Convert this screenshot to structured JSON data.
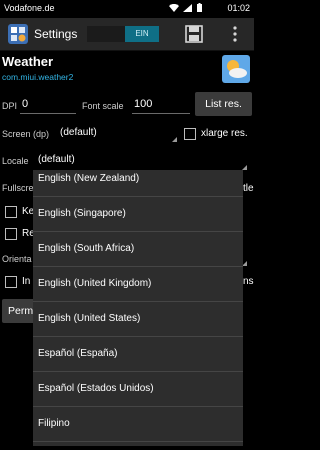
{
  "status_bar": {
    "carrier": "Vodafone.de",
    "time": "01:02"
  },
  "action_bar": {
    "title": "Settings",
    "toggle_label": "EIN"
  },
  "app": {
    "name": "Weather",
    "package": "com.miui.weather2"
  },
  "form": {
    "dpi_label": "DPI",
    "dpi_value": "0",
    "font_scale_label": "Font scale",
    "font_scale_value": "100",
    "list_res_button": "List res.",
    "screen_label": "Screen (dp)",
    "screen_value": "(default)",
    "xlarge_label": "xlarge res.",
    "locale_label": "Locale",
    "locale_value": "(default)",
    "fullscreen_partial": "Fullscre",
    "tle_partial": "tle",
    "ke_partial": "Ke",
    "re_partial": "Re",
    "orienta_partial": "Orienta",
    "in_partial": "In",
    "ns_partial": "ns",
    "perm_partial": "Perm"
  },
  "dropdown": {
    "items": [
      "English (New Zealand)",
      "English (Singapore)",
      "English (South Africa)",
      "English (United Kingdom)",
      "English (United States)",
      "Español (España)",
      "Español (Estados Unidos)",
      "Filipino"
    ]
  },
  "colors": {
    "accent": "#33b5e5",
    "toggle_on": "#0f6f86",
    "action_bar": "#272727",
    "dropdown_bg": "#2d2d2d"
  }
}
